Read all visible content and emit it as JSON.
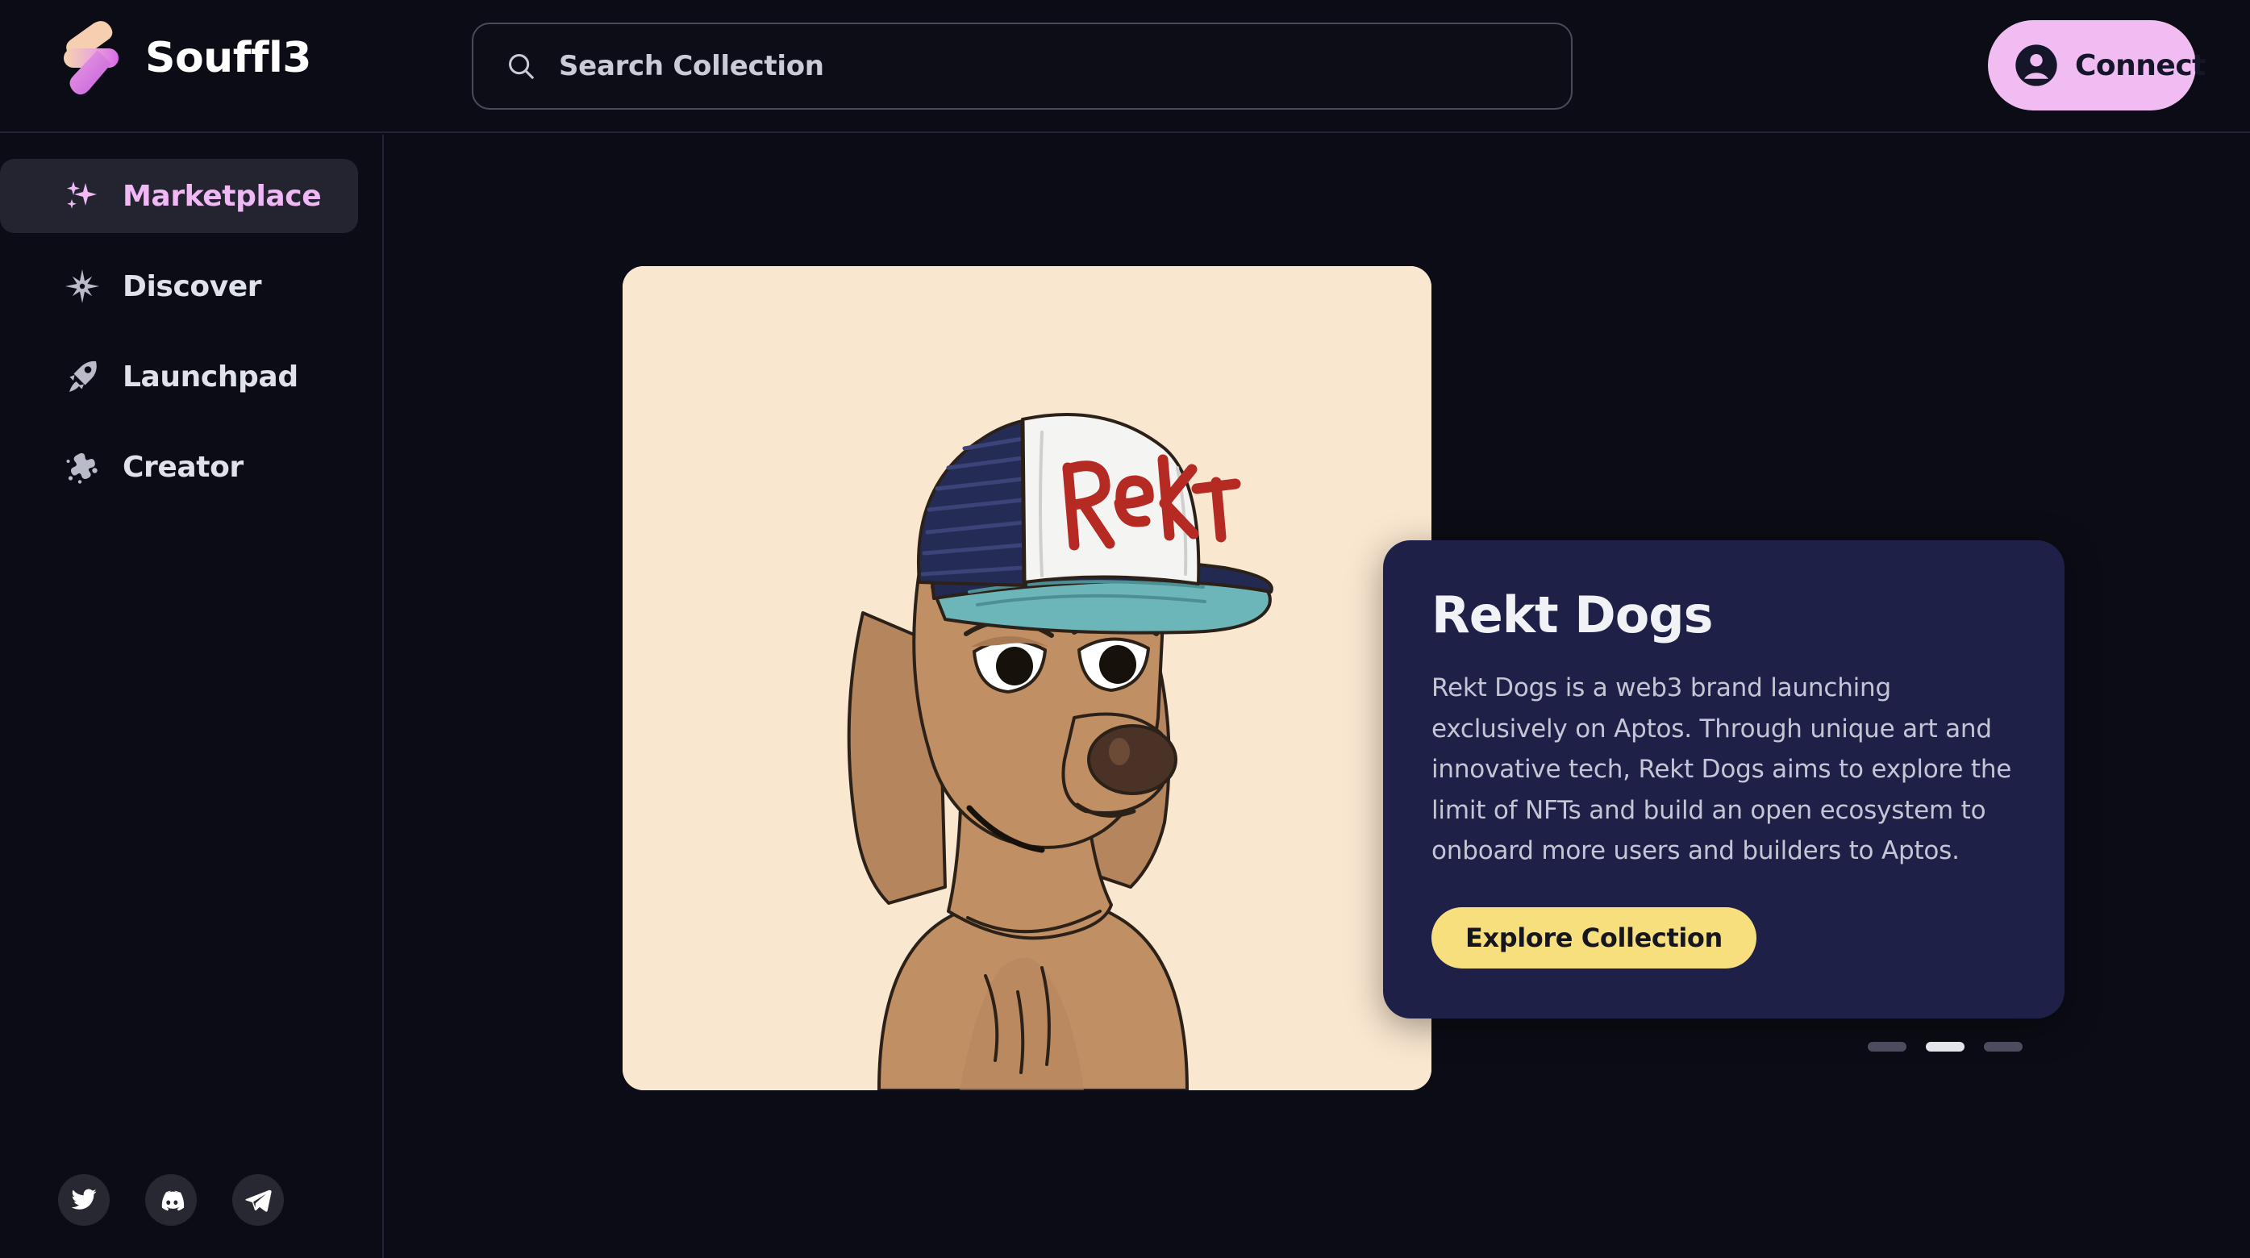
{
  "header": {
    "brand_name": "Souffl3",
    "logo_icon": "souffl3-logo",
    "search": {
      "placeholder": "Search Collection",
      "value": "",
      "icon": "search-icon"
    },
    "connect": {
      "label": "Connect",
      "icon": "person-icon",
      "color": "#f0bcf2"
    }
  },
  "sidebar": {
    "items": [
      {
        "label": "Marketplace",
        "icon": "sparkles-icon",
        "active": true
      },
      {
        "label": "Discover",
        "icon": "compass-star-icon",
        "active": false
      },
      {
        "label": "Launchpad",
        "icon": "rocket-icon",
        "active": false
      },
      {
        "label": "Creator",
        "icon": "paint-splat-icon",
        "active": false
      }
    ],
    "active_color": "#f0b9f6",
    "socials": [
      {
        "name": "twitter-icon"
      },
      {
        "name": "discord-icon"
      },
      {
        "name": "telegram-icon"
      }
    ]
  },
  "hero": {
    "artwork": {
      "alt": "Rekt Dogs NFT artwork - cartoon dog wearing trucker cap",
      "background_color": "#fae7d0",
      "cap_text": "Rekt"
    },
    "card": {
      "title": "Rekt Dogs",
      "description": "Rekt Dogs is a web3 brand launching exclusively on Aptos. Through unique art and innovative tech, Rekt Dogs aims to explore the limit of NFTs and build an open ecosystem to onboard more users and builders to Aptos.",
      "cta_label": "Explore Collection",
      "cta_color": "#f8df7e",
      "background_color": "#1e2048"
    },
    "carousel": {
      "total": 3,
      "active_index": 1
    }
  },
  "theme": {
    "page_background": "#0c0c16",
    "border": "#21243a",
    "accent_pink": "#f0b9f6",
    "accent_yellow": "#f8df7e"
  }
}
